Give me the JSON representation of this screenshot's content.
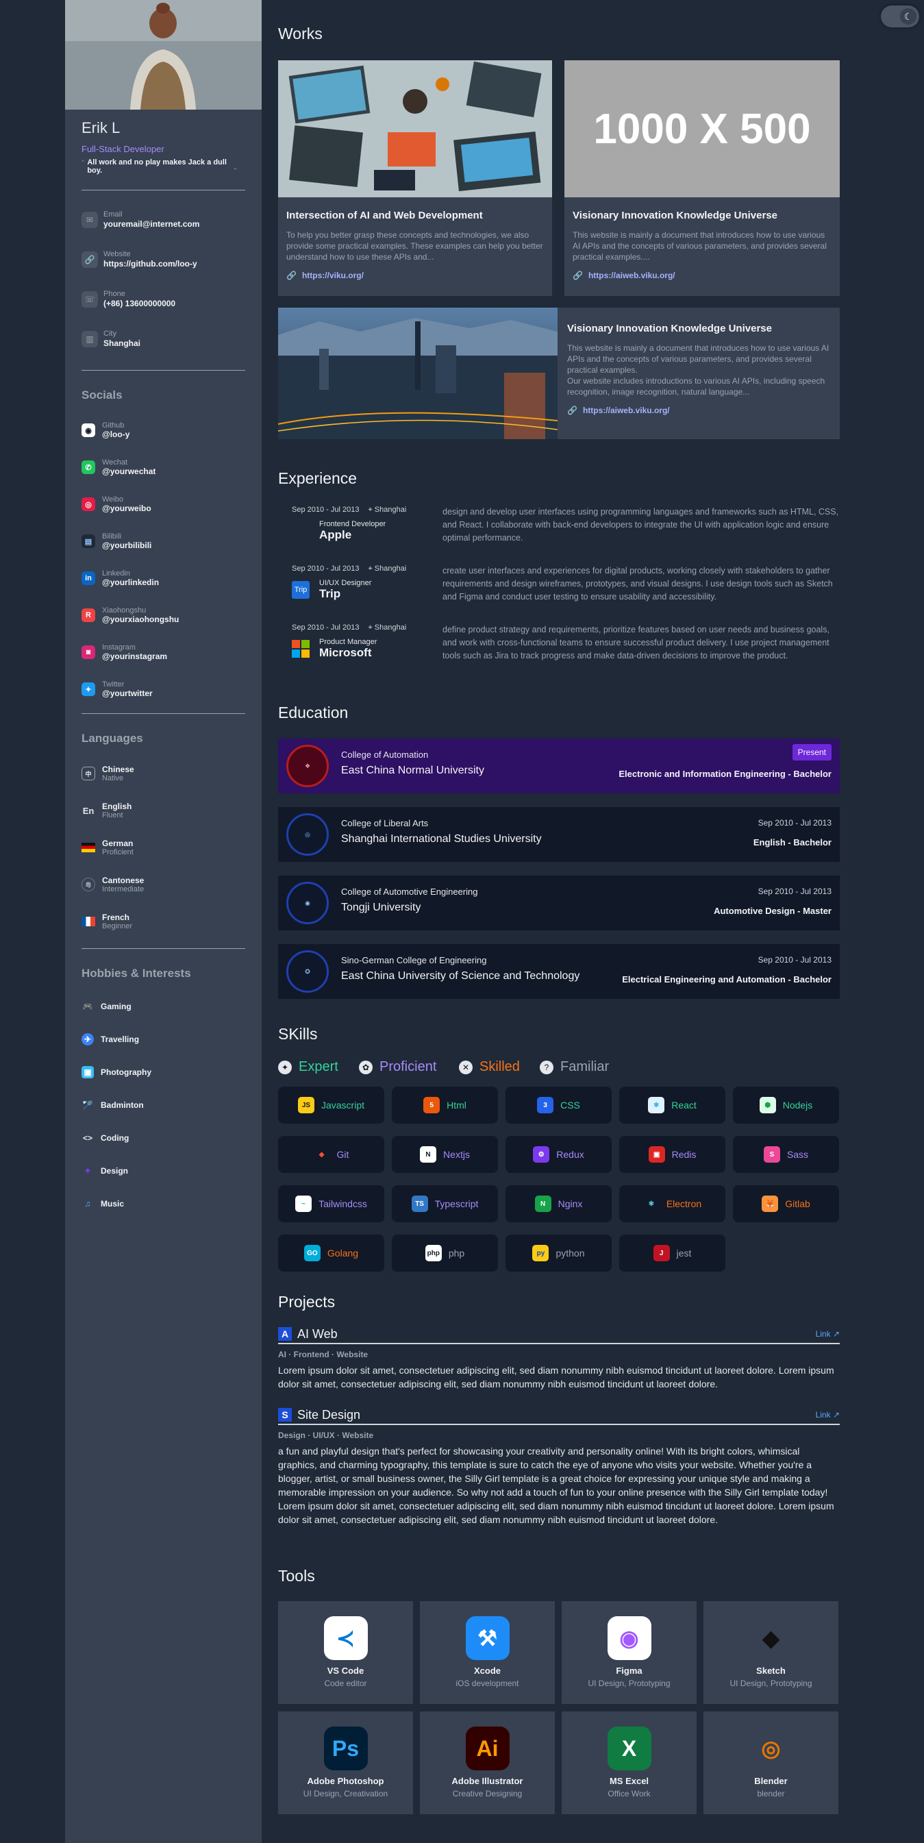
{
  "profile": {
    "name": "Erik L",
    "role": "Full-Stack Developer",
    "quote": "All work and no play makes Jack a dull boy."
  },
  "contacts": [
    {
      "label": "Email",
      "value": "youremail@internet.com",
      "icon": "mail-icon"
    },
    {
      "label": "Website",
      "value": "https://github.com/loo-y",
      "icon": "link-icon"
    },
    {
      "label": "Phone",
      "value": "(+86) 13600000000",
      "icon": "phone-icon"
    },
    {
      "label": "City",
      "value": "Shanghai",
      "icon": "building-icon"
    }
  ],
  "socials": {
    "title": "Socials",
    "items": [
      {
        "name": "Github",
        "handle": "@loo-y",
        "color": "#ffffff",
        "fg": "#111827"
      },
      {
        "name": "Wechat",
        "handle": "@yourwechat",
        "color": "#22c55e",
        "fg": "#ffffff"
      },
      {
        "name": "Weibo",
        "handle": "@yourweibo",
        "color": "#e11d48",
        "fg": "#ffffff"
      },
      {
        "name": "Bilibili",
        "handle": "@yourbilibili",
        "color": "#1f2937",
        "fg": "#93c5fd"
      },
      {
        "name": "Linkedin",
        "handle": "@yourlinkedin",
        "color": "#0a66c2",
        "fg": "#ffffff"
      },
      {
        "name": "Xiaohongshu",
        "handle": "@yourxiaohongshu",
        "color": "#ef4444",
        "fg": "#ffffff"
      },
      {
        "name": "Instagram",
        "handle": "@yourinstagram",
        "color": "#db2777",
        "fg": "#ffffff"
      },
      {
        "name": "Twitter",
        "handle": "@yourtwitter",
        "color": "#1d9bf0",
        "fg": "#ffffff"
      }
    ]
  },
  "languages": {
    "title": "Languages",
    "items": [
      {
        "name": "Chinese",
        "level": "Native"
      },
      {
        "name": "English",
        "level": "Fluent"
      },
      {
        "name": "German",
        "level": "Proficient"
      },
      {
        "name": "Cantonese",
        "level": "Intermediate"
      },
      {
        "name": "French",
        "level": "Beginner"
      }
    ]
  },
  "hobbies": {
    "title": "Hobbies & Interests",
    "items": [
      "Gaming",
      "Travelling",
      "Photography",
      "Badminton",
      "Coding",
      "Design",
      "Music"
    ]
  },
  "works": {
    "title": "Works",
    "placeholder_text": "1000 X 500",
    "items": [
      {
        "title": "Intersection of AI and Web Development",
        "desc": "To help you better grasp these concepts and technologies, we also provide some practical examples. These examples can help you better understand how to use these APIs and...",
        "link": "https://viku.org/"
      },
      {
        "title": "Visionary Innovation Knowledge Universe",
        "desc": "This website is mainly a document that introduces how to use various AI APIs and the concepts of various parameters, and provides several practical examples....",
        "link": "https://aiweb.viku.org/"
      },
      {
        "title": "Visionary Innovation Knowledge Universe",
        "desc": "This website is mainly a document that introduces how to use various AI APIs and the concepts of various parameters, and provides several practical examples.",
        "desc2": "Our website includes introductions to various AI APIs, including speech recognition, image recognition, natural language...",
        "link": "https://aiweb.viku.org/"
      }
    ]
  },
  "experience": {
    "title": "Experience",
    "items": [
      {
        "date": "Sep 2010 - Jul 2013",
        "city": "Shanghai",
        "role": "Frontend Developer",
        "company": "Apple",
        "desc": "design and develop user interfaces using programming languages and frameworks such as HTML, CSS, and React. I collaborate with back-end developers to integrate the UI with application logic and ensure optimal performance."
      },
      {
        "date": "Sep 2010 - Jul 2013",
        "city": "Shanghai",
        "role": "UI/UX Designer",
        "company": "Trip",
        "desc": "create user interfaces and experiences for digital products, working closely with stakeholders to gather requirements and design wireframes, prototypes, and visual designs. I use design tools such as Sketch and Figma and conduct user testing to ensure usability and accessibility."
      },
      {
        "date": "Sep 2010 - Jul 2013",
        "city": "Shanghai",
        "role": "Product Manager",
        "company": "Microsoft",
        "desc": "define product strategy and requirements, prioritize features based on user needs and business goals, and work with cross-functional teams to ensure successful product delivery. I use project management tools such as Jira to track progress and make data-driven decisions to improve the product."
      }
    ]
  },
  "education": {
    "title": "Education",
    "items": [
      {
        "college": "College of Automation",
        "university": "East China Normal University",
        "date": "Present",
        "degree": "Electronic and Information Engineering - Bachelor",
        "active": true
      },
      {
        "college": "College of Liberal Arts",
        "university": "Shanghai International Studies University",
        "date": "Sep 2010 - Jul 2013",
        "degree": "English - Bachelor",
        "active": false
      },
      {
        "college": "College of Automotive Engineering",
        "university": "Tongji University",
        "date": "Sep 2010 - Jul 2013",
        "degree": "Automotive Design - Master",
        "active": false
      },
      {
        "college": "Sino-German College of Engineering",
        "university": "East China University of Science and Technology",
        "date": "Sep 2010 - Jul 2013",
        "degree": "Electrical Engineering and Automation - Bachelor",
        "active": false
      }
    ]
  },
  "skills": {
    "title": "SKills",
    "levels": [
      {
        "name": "Expert",
        "color": "#34d399"
      },
      {
        "name": "Proficient",
        "color": "#a78bfa"
      },
      {
        "name": "Skilled",
        "color": "#f97316"
      },
      {
        "name": "Familiar",
        "color": "#9ca3af"
      }
    ],
    "items": [
      {
        "name": "Javascript",
        "level": 0,
        "icon": "JS",
        "bg": "#facc15",
        "fg": "#111827"
      },
      {
        "name": "Html",
        "level": 0,
        "icon": "5",
        "bg": "#ea580c",
        "fg": "#ffffff"
      },
      {
        "name": "CSS",
        "level": 0,
        "icon": "3",
        "bg": "#2563eb",
        "fg": "#ffffff"
      },
      {
        "name": "React",
        "level": 0,
        "icon": "⚛",
        "bg": "#e0f2fe",
        "fg": "#0ea5e9"
      },
      {
        "name": "Nodejs",
        "level": 0,
        "icon": "⬢",
        "bg": "#dcfce7",
        "fg": "#16a34a"
      },
      {
        "name": "Git",
        "level": 1,
        "icon": "◆",
        "bg": "#111827",
        "fg": "#f05033"
      },
      {
        "name": "Nextjs",
        "level": 1,
        "icon": "N",
        "bg": "#ffffff",
        "fg": "#111827"
      },
      {
        "name": "Redux",
        "level": 1,
        "icon": "⚙",
        "bg": "#7c3aed",
        "fg": "#ffffff"
      },
      {
        "name": "Redis",
        "level": 1,
        "icon": "▣",
        "bg": "#dc2626",
        "fg": "#ffffff"
      },
      {
        "name": "Sass",
        "level": 1,
        "icon": "S",
        "bg": "#ec4899",
        "fg": "#ffffff"
      },
      {
        "name": "Tailwindcss",
        "level": 1,
        "icon": "~",
        "bg": "#ffffff",
        "fg": "#06b6d4"
      },
      {
        "name": "Typescript",
        "level": 1,
        "icon": "TS",
        "bg": "#3178c6",
        "fg": "#ffffff"
      },
      {
        "name": "Nginx",
        "level": 1,
        "icon": "N",
        "bg": "#16a34a",
        "fg": "#ffffff"
      },
      {
        "name": "Electron",
        "level": 2,
        "icon": "⚛",
        "bg": "#111827",
        "fg": "#67e8f9"
      },
      {
        "name": "Gitlab",
        "level": 2,
        "icon": "🦊",
        "bg": "#fb923c",
        "fg": "#ffffff"
      },
      {
        "name": "Golang",
        "level": 2,
        "icon": "GO",
        "bg": "#00add8",
        "fg": "#ffffff"
      },
      {
        "name": "php",
        "level": 3,
        "icon": "php",
        "bg": "#ffffff",
        "fg": "#111827"
      },
      {
        "name": "python",
        "level": 3,
        "icon": "py",
        "bg": "#facc15",
        "fg": "#1e40af"
      },
      {
        "name": "jest",
        "level": 3,
        "icon": "J",
        "bg": "#c21325",
        "fg": "#ffffff"
      }
    ]
  },
  "projects": {
    "title": "Projects",
    "items": [
      {
        "icon": "A",
        "title": "AI Web",
        "link": "Link ↗",
        "tags": "AI · Frontend · Website",
        "body": [
          "Lorem ipsum dolor sit amet, consectetuer adipiscing elit, sed diam nonummy nibh euismod tincidunt ut laoreet dolore. Lorem ipsum dolor sit amet, consectetuer adipiscing elit, sed diam nonummy nibh euismod tincidunt ut laoreet dolore."
        ]
      },
      {
        "icon": "S",
        "title": "Site Design",
        "link": "Link ↗",
        "tags": "Design · UI/UX · Website",
        "body": [
          "a fun and playful design that's perfect for showcasing your creativity and personality online! With its bright colors, whimsical graphics, and charming typography, this template is sure to catch the eye of anyone who visits your website. Whether you're a blogger, artist, or small business owner, the Silly Girl template is a great choice for expressing your unique style and making a memorable impression on your audience. So why not add a touch of fun to your online presence with the Silly Girl template today!",
          "Lorem ipsum dolor sit amet, consectetuer adipiscing elit, sed diam nonummy nibh euismod tincidunt ut laoreet dolore. Lorem ipsum dolor sit amet, consectetuer adipiscing elit, sed diam nonummy nibh euismod tincidunt ut laoreet dolore."
        ]
      }
    ]
  },
  "tools": {
    "title": "Tools",
    "items": [
      {
        "name": "VS Code",
        "desc": "Code editor",
        "glyph": "≺",
        "bg": "#ffffff",
        "fg": "#0078d4"
      },
      {
        "name": "Xcode",
        "desc": "iOS development",
        "glyph": "⚒",
        "bg": "#1d8cf8",
        "fg": "#ffffff"
      },
      {
        "name": "Figma",
        "desc": "UI Design, Prototyping",
        "glyph": "◉",
        "bg": "#ffffff",
        "fg": "#a259ff"
      },
      {
        "name": "Sketch",
        "desc": "UI Design, Prototyping",
        "glyph": "◆",
        "bg": "#374151",
        "fg": "#111111"
      },
      {
        "name": "Adobe Photoshop",
        "desc": "UI Design, Creativation",
        "glyph": "Ps",
        "bg": "#001e36",
        "fg": "#31a8ff"
      },
      {
        "name": "Adobe Illustrator",
        "desc": "Creative Designing",
        "glyph": "Ai",
        "bg": "#330000",
        "fg": "#ff9a00"
      },
      {
        "name": "MS Excel",
        "desc": "Office Work",
        "glyph": "X",
        "bg": "#107c41",
        "fg": "#ffffff"
      },
      {
        "name": "Blender",
        "desc": "blender",
        "glyph": "◎",
        "bg": "#374151",
        "fg": "#ea7600"
      }
    ]
  },
  "theme_toggle": {
    "icon": "moon-icon",
    "glyph": "☾"
  }
}
